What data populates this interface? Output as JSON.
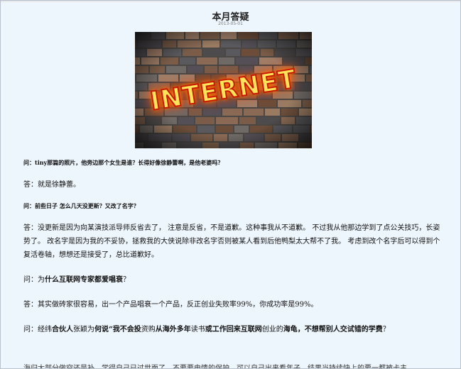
{
  "article": {
    "title": "本月答疑",
    "date": "2013-05-01",
    "banner_text": "INTERNET",
    "qa": [
      {
        "q": "问：tiny那篇的照片，他旁边那个女生是谁？长得好像徐静蕾啊，是他老婆吗？",
        "a": "答：就是徐静蕾。"
      },
      {
        "q": "问：前些日子 怎么几天没更新？又改了名字？",
        "a": "答：没更新是因为向某演技派导师反省去了， 注意是反省，不是道歉。这种事我从不道歉。 不过我从他那边学到了点公关技巧，长姿势了。 改名字是因为我的不妥协，拯救我的大侠说除非改名字否则被某人看到后他鸭梨太大帮不了我。 考虑到改个名字后可以得到个复活卷轴，想想还是接受了，总比道歉好。"
      },
      {
        "q_prefix": "问：为",
        "q_bold1": "什么互联网专家都爱唱衰",
        "q_suffix": "？",
        "a": "答：其实做砖家很容易，出一个产品唱衰一个产品，反正创业失败率99%，你成功率是99%。"
      },
      {
        "q_prefix": "问：经纬",
        "q_bold1": "合伙人",
        "q_mid": "张颖为",
        "q_bold2": "何说“我不会投",
        "q_mid2": "资购",
        "q_bold3": "从海外多年",
        "q_mid3": "读书",
        "q_bold4": "或工作回来互联网",
        "q_mid4": "创业的",
        "q_bold5": "海龟，不想帮别人交试错的学费",
        "q_suffix": "？"
      }
    ],
    "cut_line": "海归大部分做空还是补，学得自己已过世面了，不要要电情的保护，可以自己出来看年子，结果当持续快上的要一都被卡主"
  }
}
